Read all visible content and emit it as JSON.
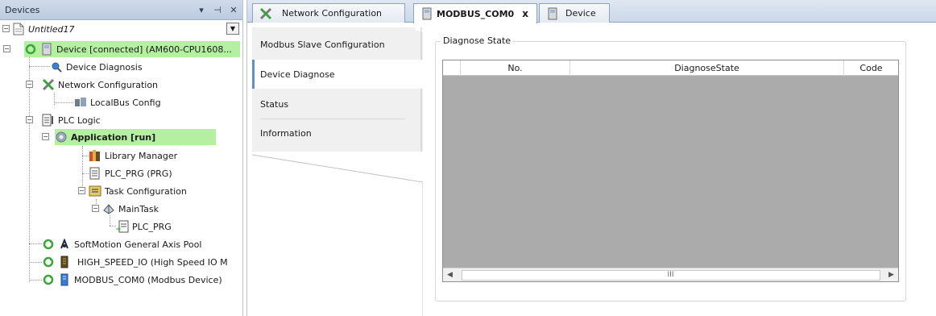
{
  "devices_pane": {
    "title": "Devices",
    "buttons": {
      "dropdown": "▾",
      "pin": "⊣",
      "close": "✕"
    }
  },
  "tree": {
    "project": "Untitled17",
    "device": "Device [connected] (AM600-CPU1608...",
    "device_diagnosis": "Device Diagnosis",
    "network_configuration": "Network Configuration",
    "localbus_config": "LocalBus Config",
    "plc_logic": "PLC Logic",
    "application": "Application [run]",
    "library_manager": "Library Manager",
    "plc_prg": "PLC_PRG (PRG)",
    "task_configuration": "Task Configuration",
    "main_task": "MainTask",
    "plc_prg_call": "PLC_PRG",
    "softmotion": "SoftMotion General Axis Pool",
    "high_speed_io": "HIGH_SPEED_IO (High Speed IO M",
    "modbus_com0": "MODBUS_COM0 (Modbus Device)"
  },
  "tabs": {
    "network": "Network Configuration",
    "modbus": "MODBUS_COM0",
    "device": "Device",
    "close_glyph": "x"
  },
  "side_tabs": {
    "slave_config": "Modbus Slave Configuration",
    "device_diagnose": "Device Diagnose",
    "status": "Status",
    "information": "Information"
  },
  "diagnose": {
    "group_title": "Diagnose State",
    "columns": {
      "no": "No.",
      "state": "DiagnoseState",
      "code": "Code"
    },
    "scroll_thumb": "III"
  },
  "colors": {
    "highlight_green": "#b5f0a2",
    "active_tab_accent": "#5d8fd1",
    "grid_empty": "#ababab"
  }
}
